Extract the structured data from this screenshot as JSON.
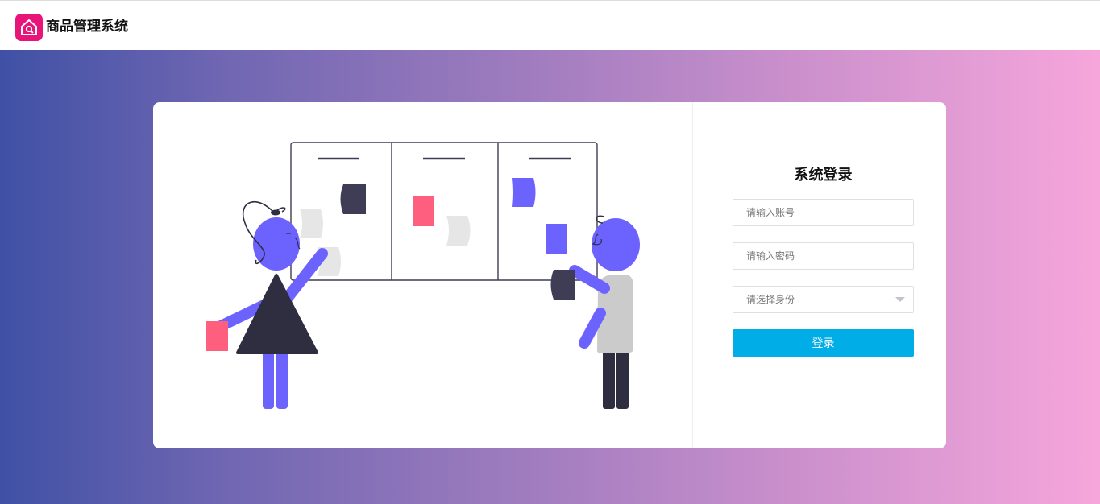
{
  "header": {
    "logo_icon": "home-search-icon",
    "logo_color": "#e8147a",
    "title": "商品管理系统"
  },
  "login": {
    "title": "系统登录",
    "account_placeholder": "请输入账号",
    "password_placeholder": "请输入密码",
    "role_placeholder": "请选择身份",
    "submit_label": "登录",
    "accent_color": "#00ade6"
  },
  "illustration": {
    "name": "team-kanban-board-illustration",
    "colors": {
      "primary": "#6c63ff",
      "dark": "#3f3d56",
      "pink": "#ff5f7e",
      "gray": "#e6e6e6"
    }
  }
}
